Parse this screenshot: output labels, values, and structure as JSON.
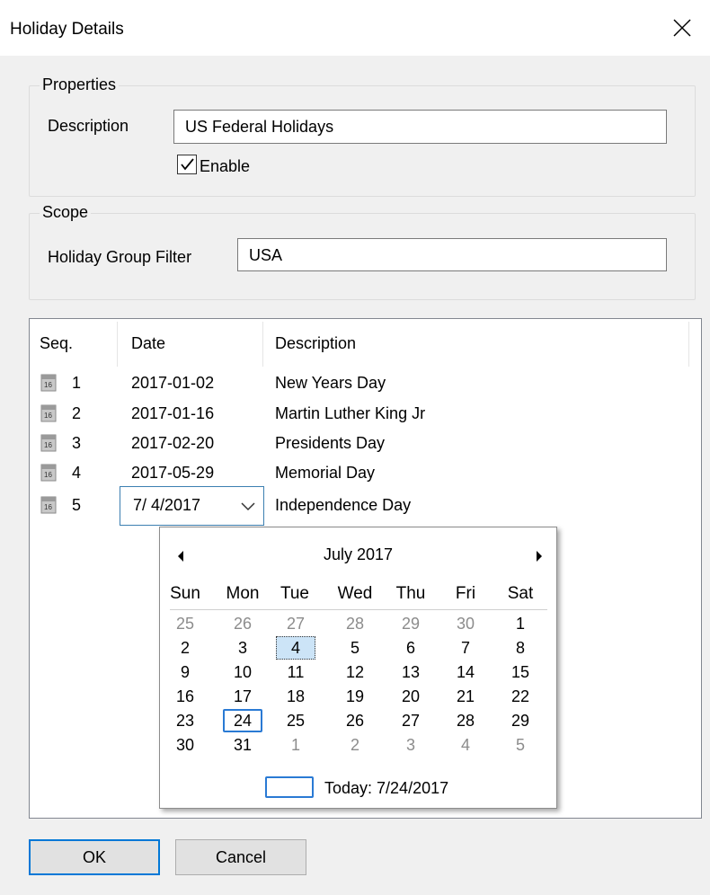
{
  "window": {
    "title": "Holiday Details"
  },
  "properties": {
    "legend": "Properties",
    "description_label": "Description",
    "description_value": "US Federal Holidays",
    "enable_label": "Enable",
    "enable_checked": true
  },
  "scope": {
    "legend": "Scope",
    "filter_label": "Holiday Group Filter",
    "filter_value": "USA"
  },
  "list": {
    "columns": [
      "Seq.",
      "Date",
      "Description"
    ],
    "rows": [
      {
        "seq": "1",
        "date": "2017-01-02",
        "description": "New Years Day"
      },
      {
        "seq": "2",
        "date": "2017-01-16",
        "description": "Martin Luther King Jr"
      },
      {
        "seq": "3",
        "date": "2017-02-20",
        "description": "Presidents Day"
      },
      {
        "seq": "4",
        "date": "2017-05-29",
        "description": "Memorial Day"
      },
      {
        "seq": "5",
        "date": "7/ 4/2017",
        "description": "Independence Day"
      }
    ],
    "row_icon": "calendar-icon"
  },
  "calendar": {
    "month_label": "July 2017",
    "day_names": [
      "Sun",
      "Mon",
      "Tue",
      "Wed",
      "Thu",
      "Fri",
      "Sat"
    ],
    "weeks": [
      [
        "25",
        "26",
        "27",
        "28",
        "29",
        "30",
        "1"
      ],
      [
        "2",
        "3",
        "4",
        "5",
        "6",
        "7",
        "8"
      ],
      [
        "9",
        "10",
        "11",
        "12",
        "13",
        "14",
        "15"
      ],
      [
        "16",
        "17",
        "18",
        "19",
        "20",
        "21",
        "22"
      ],
      [
        "23",
        "24",
        "25",
        "26",
        "27",
        "28",
        "29"
      ],
      [
        "30",
        "31",
        "1",
        "2",
        "3",
        "4",
        "5"
      ]
    ],
    "today_label": "Today: 7/24/2017"
  },
  "buttons": {
    "ok": "OK",
    "cancel": "Cancel"
  },
  "colors": {
    "accent": "#0078d7",
    "today_border": "#2a7ad4"
  }
}
